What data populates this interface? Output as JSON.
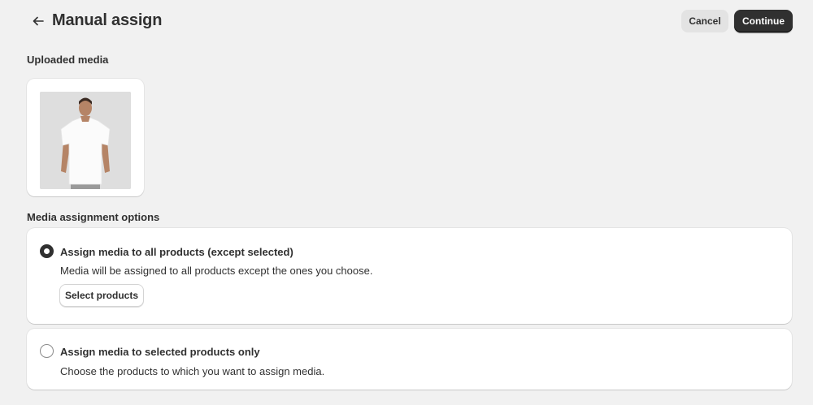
{
  "header": {
    "back_icon": "arrow-left-icon",
    "title": "Manual assign",
    "cancel_label": "Cancel",
    "continue_label": "Continue"
  },
  "uploaded_media": {
    "heading": "Uploaded media",
    "image_alt": "Man wearing a white t-shirt"
  },
  "assignment": {
    "heading": "Media assignment options",
    "options": [
      {
        "label": "Assign media to all products (except selected)",
        "description": "Media will be assigned to all products except the ones you choose.",
        "selected": true,
        "button_label": "Select products"
      },
      {
        "label": "Assign media to selected products only",
        "description": "Choose the products to which you want to assign media.",
        "selected": false
      }
    ]
  },
  "colors": {
    "background": "#f1f1f1",
    "card": "#ffffff",
    "primary_button": "#303030",
    "secondary_button": "#e3e3e3",
    "text": "#303030"
  }
}
